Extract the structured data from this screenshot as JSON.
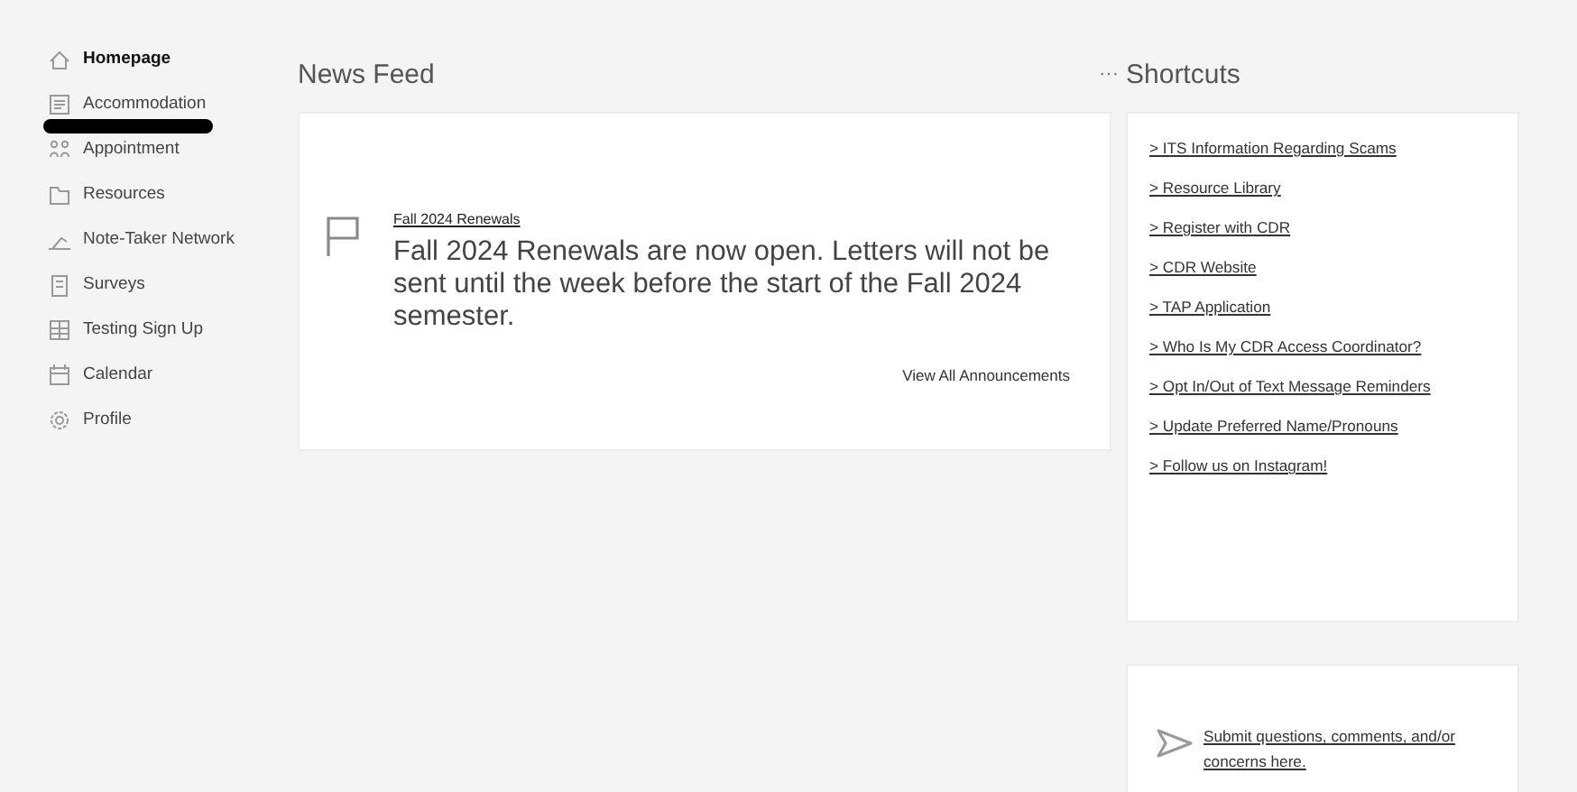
{
  "sidebar": {
    "items": [
      {
        "label": "Homepage",
        "selected": true
      },
      {
        "label": "Accommodation",
        "selected": false
      },
      {
        "label": "Appointment",
        "selected": false
      },
      {
        "label": "Resources",
        "selected": false
      },
      {
        "label": "Note-Taker Network",
        "selected": false
      },
      {
        "label": "Surveys",
        "selected": false
      },
      {
        "label": "Testing Sign Up",
        "selected": false
      },
      {
        "label": "Calendar",
        "selected": false
      },
      {
        "label": "Profile",
        "selected": false
      }
    ]
  },
  "news_feed": {
    "title": "News Feed",
    "menu": "···",
    "announcement": {
      "title": "Fall 2024 Renewals",
      "body": "Fall 2024 Renewals are now open. Letters will not be sent until the week before the start of the Fall 2024 semester."
    },
    "view_all": "View All Announcements"
  },
  "shortcuts": {
    "title": "Shortcuts",
    "links": [
      "> ITS Information Regarding Scams",
      "> Resource Library",
      "> Register with CDR",
      "> CDR Website",
      "> TAP Application",
      "> Who Is My CDR Access Coordinator?",
      "> Opt In/Out of Text Message Reminders",
      "> Update Preferred Name/Pronouns",
      "> Follow us on Instagram!"
    ]
  },
  "feedback": {
    "link": "Submit questions, comments, and/or concerns here."
  }
}
